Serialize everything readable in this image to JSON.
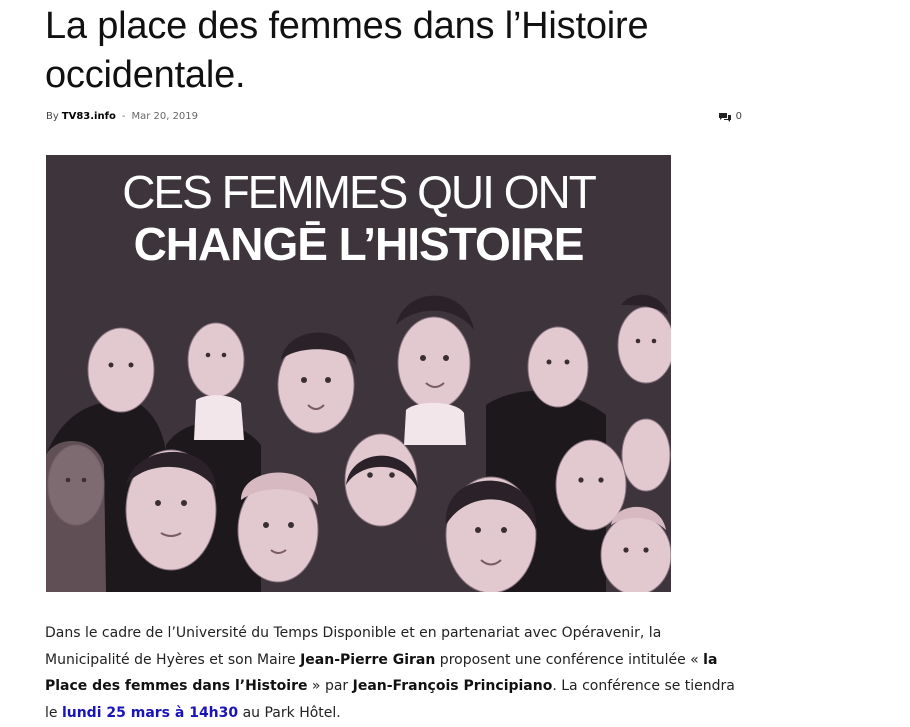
{
  "article": {
    "title": "La place des femmes dans l’Histoire occidentale.",
    "meta": {
      "by_label": "By",
      "author": "TV83.info",
      "separator": "-",
      "date": "Mar 20, 2019",
      "comment_count": "0",
      "comment_icon": "comments-icon"
    },
    "image": {
      "title_line1": "CES FEMMES QUI ONT",
      "title_line2": "CHANGĒ L’HISTOIRE",
      "background_color": "#3d343c",
      "tint_color": "#e2c9d0"
    },
    "body": {
      "t1": "Dans le cadre de l’Université du Temps Disponible et en partenariat avec Opéravenir, la Municipalité de Hyères et son Maire ",
      "b1": "Jean-Pierre Giran",
      "t2": " proposent une conférence intitulée « ",
      "b2": "la Place des femmes dans l’Histoire",
      "t3": " » par ",
      "b3": "Jean-François Principiano",
      "t4": ". La conférence se tiendra le ",
      "h1": "lundi 25 mars à 14h30",
      "t5": " au Park Hôtel.",
      "highlight_color": "#1a13b8"
    }
  }
}
